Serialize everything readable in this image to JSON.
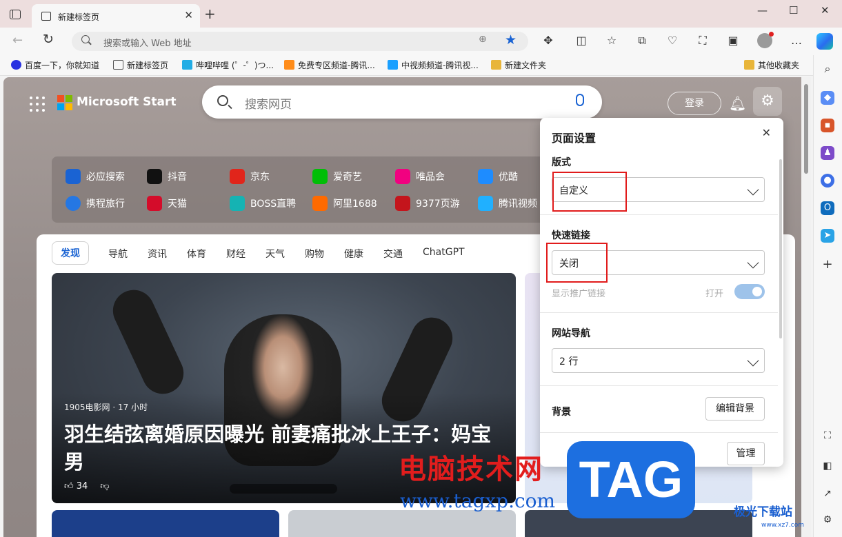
{
  "browser": {
    "tab_title": "新建标签页",
    "tab_close": "✕",
    "new_tab": "+",
    "window_controls": [
      "—",
      "☐",
      "✕"
    ],
    "address_placeholder": "搜索或输入 Web 地址",
    "favorites": [
      {
        "label": "百度一下，你就知道",
        "color": "#2932e1"
      },
      {
        "label": "新建标签页",
        "color": "#555555"
      },
      {
        "label": "哔哩哔哩 (゜-゜)つ...",
        "color": "#23ade5"
      },
      {
        "label": "免费专区频道-腾讯...",
        "color": "#ff8c1a"
      },
      {
        "label": "中视频频道-腾讯视...",
        "color": "#1aa0ff"
      },
      {
        "label": "新建文件夹",
        "color": "#e8b53a"
      },
      {
        "label": "其他收藏夹",
        "color": "#e8b53a"
      }
    ]
  },
  "page": {
    "brand": "Microsoft Start",
    "search_placeholder": "搜索网页",
    "login": "登录",
    "quick_links": [
      {
        "label": "必应搜索",
        "color": "#1a63d3"
      },
      {
        "label": "抖音",
        "color": "#111111"
      },
      {
        "label": "京东",
        "color": "#e1251b"
      },
      {
        "label": "爱奇艺",
        "color": "#00be06"
      },
      {
        "label": "唯品会",
        "color": "#f10180"
      },
      {
        "label": "优酷",
        "color": "#1e8cff"
      },
      {
        "label": "携程旅行",
        "color": "#2577e3"
      },
      {
        "label": "天猫",
        "color": "#d40c2a"
      },
      {
        "label": "BOSS直聘",
        "color": "#15b3b3"
      },
      {
        "label": "阿里1688",
        "color": "#ff6a00"
      },
      {
        "label": "9377页游",
        "color": "#c4151c"
      },
      {
        "label": "腾讯视频",
        "color": "#20b0ff"
      }
    ],
    "feed_tabs": [
      "发现",
      "导航",
      "资讯",
      "体育",
      "财经",
      "天气",
      "购物",
      "健康",
      "交通",
      "ChatGPT"
    ],
    "hero": {
      "source": "1905电影网 · 17 小时",
      "title": "羽生结弦离婚原因曝光 前妻痛批冰上王子：妈宝男",
      "likes": "34"
    }
  },
  "settings_panel": {
    "title": "页面设置",
    "close": "✕",
    "layout_label": "版式",
    "layout_value": "自定义",
    "quicklinks_label": "快速链接",
    "quicklinks_value": "关闭",
    "promo_label": "显示推广链接",
    "promo_state": "打开",
    "sitenav_label": "网站导航",
    "sitenav_value": "2 行",
    "background_label": "背景",
    "background_button": "编辑背景",
    "manage_button": "管理"
  },
  "watermark": {
    "cn": "电脑技术网",
    "url": "www.tagxp.com",
    "tag": "TAG",
    "corner": "极光下载站",
    "corner_url": "www.xz7.com"
  }
}
